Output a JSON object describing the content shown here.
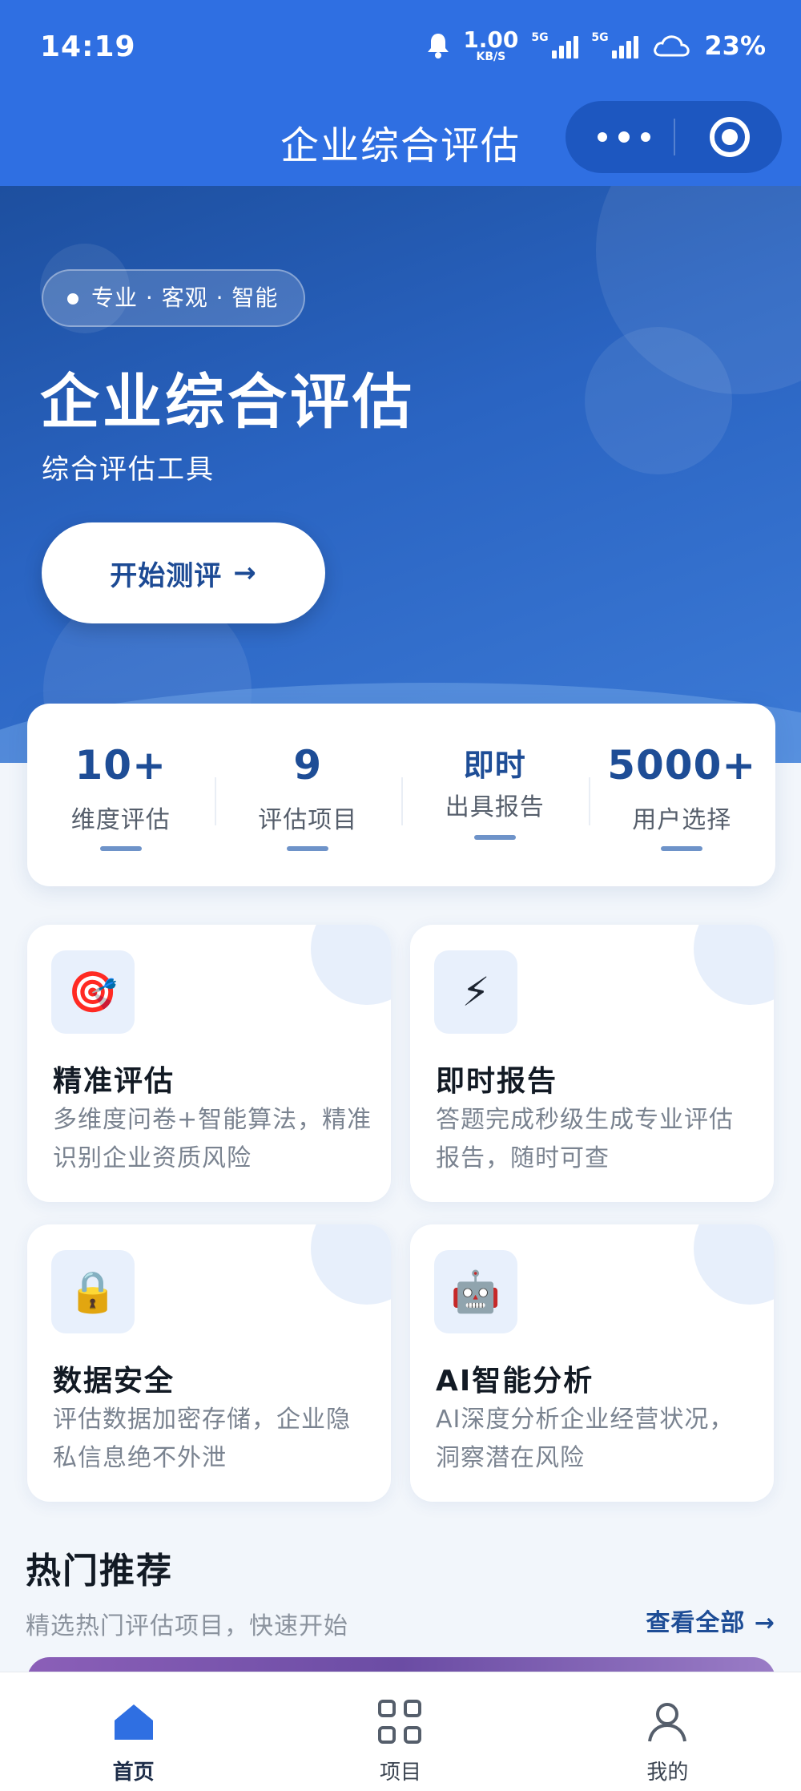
{
  "status_bar": {
    "time": "14:19",
    "net_speed_value": "1.00",
    "net_speed_unit": "KB/S",
    "signal1_label": "5G",
    "signal2_label": "5G",
    "battery": "23%",
    "icons": [
      "bell-icon",
      "signal-icon",
      "signal-icon",
      "cloud-icon"
    ]
  },
  "nav": {
    "title": "企业综合评估",
    "more_icon": "more-dots-icon",
    "close_icon": "target-icon"
  },
  "hero": {
    "chip": "专业 · 客观 · 智能",
    "title": "企业综合评估",
    "subtitle": "综合评估工具",
    "cta_label": "开始测评",
    "cta_arrow": "→"
  },
  "stats": [
    {
      "value": "10+",
      "label": "维度评估"
    },
    {
      "value": "9",
      "label": "评估项目"
    },
    {
      "value": "即时",
      "label": "出具报告"
    },
    {
      "value": "5000+",
      "label": "用户选择"
    }
  ],
  "features": [
    {
      "icon": "🎯",
      "icon_name": "target-dart-icon",
      "title": "精准评估",
      "desc": "多维度问卷+智能算法，精准识别企业资质风险"
    },
    {
      "icon": "⚡",
      "icon_name": "lightning-icon",
      "title": "即时报告",
      "desc": "答题完成秒级生成专业评估报告，随时可查"
    },
    {
      "icon": "🔒",
      "icon_name": "lock-icon",
      "title": "数据安全",
      "desc": "评估数据加密存储，企业隐私信息绝不外泄"
    },
    {
      "icon": "🤖",
      "icon_name": "robot-icon",
      "title": "AI智能分析",
      "desc": "AI深度分析企业经营状况，洞察潜在风险"
    }
  ],
  "hot": {
    "title": "热门推荐",
    "subtitle": "精选热门评估项目，快速开始",
    "view_all": "查看全部 →"
  },
  "tabbar": [
    {
      "label": "首页",
      "icon": "home-icon",
      "active": true
    },
    {
      "label": "项目",
      "icon": "grid-icon",
      "active": false
    },
    {
      "label": "我的",
      "icon": "user-icon",
      "active": false
    }
  ],
  "colors": {
    "primary": "#2f6fe2",
    "accent_text": "#1e4d96",
    "background": "#f2f6fb"
  }
}
